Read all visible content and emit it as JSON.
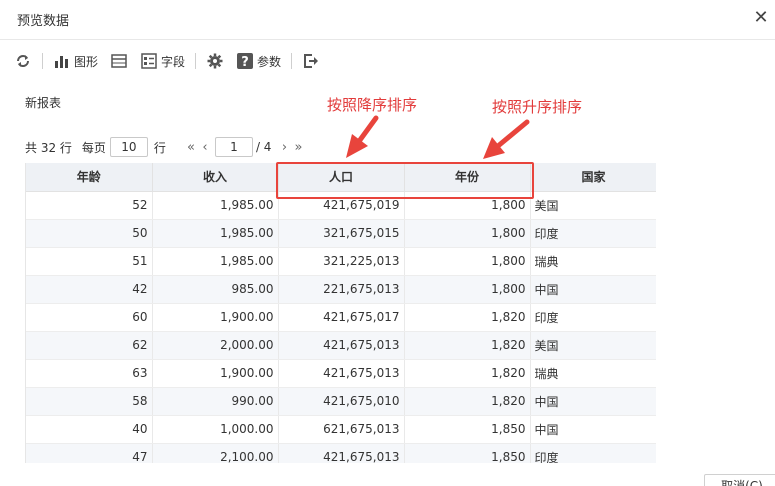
{
  "dialog": {
    "title": "预览数据",
    "close_glyph": "✕"
  },
  "toolbar": {
    "refresh_icon": "refresh-icon",
    "chart_label": "图形",
    "table_icon": "table-icon",
    "fields_label": "字段",
    "settings_icon": "gear-icon",
    "params_label": "参数",
    "export_icon": "export-icon"
  },
  "report": {
    "name": "新报表"
  },
  "annotations": {
    "desc_sort": "按照降序排序",
    "asc_sort": "按照升序排序",
    "color": "#e23b3b"
  },
  "pager": {
    "total_text": "共 32 行",
    "per_page_label": "每页",
    "page_size": "10",
    "rows_suffix": "行",
    "first_glyph": "«",
    "prev_glyph": "‹",
    "current_page": "1",
    "total_pages_text": "/ 4",
    "next_glyph": "›",
    "last_glyph": "»"
  },
  "table": {
    "columns": [
      "年龄",
      "收入",
      "人口",
      "年份",
      "国家"
    ],
    "rows": [
      [
        "52",
        "1,985.00",
        "421,675,019",
        "1,800",
        "美国"
      ],
      [
        "50",
        "1,985.00",
        "321,675,015",
        "1,800",
        "印度"
      ],
      [
        "51",
        "1,985.00",
        "321,225,013",
        "1,800",
        "瑞典"
      ],
      [
        "42",
        "985.00",
        "221,675,013",
        "1,800",
        "中国"
      ],
      [
        "60",
        "1,900.00",
        "421,675,017",
        "1,820",
        "印度"
      ],
      [
        "62",
        "2,000.00",
        "421,675,013",
        "1,820",
        "美国"
      ],
      [
        "63",
        "1,900.00",
        "421,675,013",
        "1,820",
        "瑞典"
      ],
      [
        "58",
        "990.00",
        "421,675,010",
        "1,820",
        "中国"
      ],
      [
        "40",
        "1,000.00",
        "621,675,013",
        "1,850",
        "中国"
      ],
      [
        "47",
        "2,100.00",
        "421,675,013",
        "1,850",
        "印度"
      ]
    ]
  },
  "footer": {
    "cancel_label": "取消(C)"
  }
}
